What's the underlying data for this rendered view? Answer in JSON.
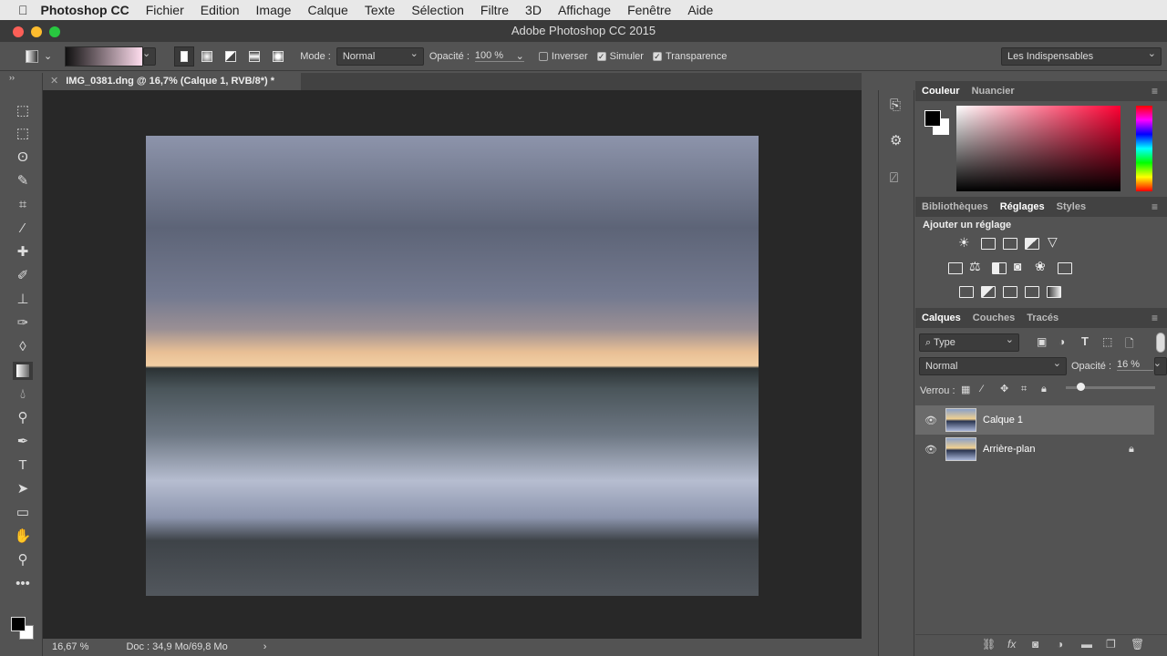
{
  "menubar": {
    "app": "Photoshop CC",
    "items": [
      "Fichier",
      "Edition",
      "Image",
      "Calque",
      "Texte",
      "Sélection",
      "Filtre",
      "3D",
      "Affichage",
      "Fenêtre",
      "Aide"
    ]
  },
  "window": {
    "title": "Adobe Photoshop CC 2015"
  },
  "options": {
    "mode_label": "Mode :",
    "mode_value": "Normal",
    "opacity_label": "Opacité :",
    "opacity_value": "100 %",
    "inverser": "Inverser",
    "simuler": "Simuler",
    "transparence": "Transparence",
    "workspace": "Les Indispensables",
    "inverser_checked": false,
    "simuler_checked": true,
    "transparence_checked": true
  },
  "document": {
    "tab": "IMG_0381.dng @ 16,7% (Calque 1, RVB/8*) *",
    "zoom": "16,67 %",
    "doc_info": "Doc : 34,9 Mo/69,8 Mo"
  },
  "color_panel": {
    "tabs": [
      "Couleur",
      "Nuancier"
    ],
    "fg": "#000000",
    "bg": "#ffffff",
    "hue": "#ff0033"
  },
  "adjust_panel": {
    "tabs": [
      "Bibliothèques",
      "Réglages",
      "Styles"
    ],
    "heading": "Ajouter un réglage"
  },
  "layers_panel": {
    "tabs": [
      "Calques",
      "Couches",
      "Tracés"
    ],
    "filter": "Type",
    "blend": "Normal",
    "opacity_label": "Opacité :",
    "opacity_value": "16 %",
    "opacity_fraction": 0.16,
    "lock_label": "Verrou :",
    "layers": [
      {
        "name": "Calque 1",
        "selected": true
      },
      {
        "name": "Arrière-plan",
        "locked": true
      }
    ]
  }
}
